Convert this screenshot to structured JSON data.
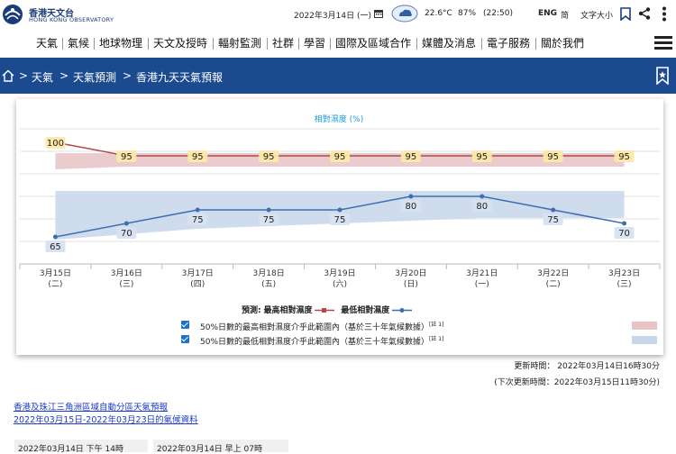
{
  "header": {
    "logo_zh": "香港天文台",
    "logo_en": "HONG KONG OBSERVATORY",
    "date": "2022年3月14日 (一)",
    "temperature": "22.6°C",
    "humidity": "87%",
    "time": "(22:50)",
    "lang_en": "ENG",
    "lang_sc": "简",
    "font_size": "文字大小"
  },
  "nav": {
    "items": [
      "天氣",
      "氣候",
      "地球物理",
      "天文及授時",
      "輻射監測",
      "社群",
      "學習",
      "國際及區域合作",
      "媒體及消息",
      "電子服務",
      "關於我們"
    ]
  },
  "breadcrumb": {
    "items": [
      "天氣",
      "天氣預測",
      "香港九天天氣預報"
    ],
    "separator": ">"
  },
  "chart_data": {
    "type": "line",
    "title": "相對濕度 (%)",
    "categories": [
      "3月15日",
      "3月16日",
      "3月17日",
      "3月18日",
      "3月19日",
      "3月20日",
      "3月21日",
      "3月22日",
      "3月23日"
    ],
    "weekdays": [
      "(二)",
      "(三)",
      "(四)",
      "(五)",
      "(六)",
      "(日)",
      "(一)",
      "(二)",
      "(三)"
    ],
    "series": [
      {
        "name": "最高相對濕度",
        "values": [
          100,
          95,
          95,
          95,
          95,
          95,
          95,
          95,
          95
        ],
        "color": "#b04a4a"
      },
      {
        "name": "最低相對濕度",
        "values": [
          65,
          70,
          75,
          75,
          75,
          80,
          80,
          75,
          70
        ],
        "color": "#3d6fb0"
      }
    ],
    "bands": [
      {
        "color": "#e8c3c6",
        "low": [
          90,
          91,
          91,
          91,
          91,
          91,
          91,
          91,
          91
        ],
        "high": [
          96,
          96,
          96,
          96,
          96,
          96,
          96,
          96,
          96
        ]
      },
      {
        "color": "#c7d6ea",
        "low": [
          64,
          66,
          68,
          69,
          70,
          71,
          72,
          72,
          72
        ],
        "high": [
          82,
          82,
          82,
          82,
          82,
          82,
          82,
          82,
          82
        ]
      }
    ],
    "ylim": [
      55,
      105
    ],
    "grid": true,
    "legend_title": "預測:",
    "legend_entries": [
      "最高相對濕度",
      "最低相對濕度"
    ],
    "band_notes": [
      "50%日數的最高相對濕度介乎此範圍內（基於三十年氣候數據）",
      "50%日數的最低相對濕度介乎此範圍內（基於三十年氣候數據）"
    ],
    "note_mark": "[註 1]"
  },
  "update": {
    "updated": "更新時間： 2022年03月14日16時30分",
    "next": "(下次更新時間：2022年03月15日11時30分)"
  },
  "links": [
    "香港及珠江三角洲區域自動分區天氣預報",
    "2022年03月15日-2022年03月23日的氣候資料"
  ],
  "tabs": [
    "2022年03月14日 下午 14時",
    "2022年03月14日 早上 07時"
  ]
}
